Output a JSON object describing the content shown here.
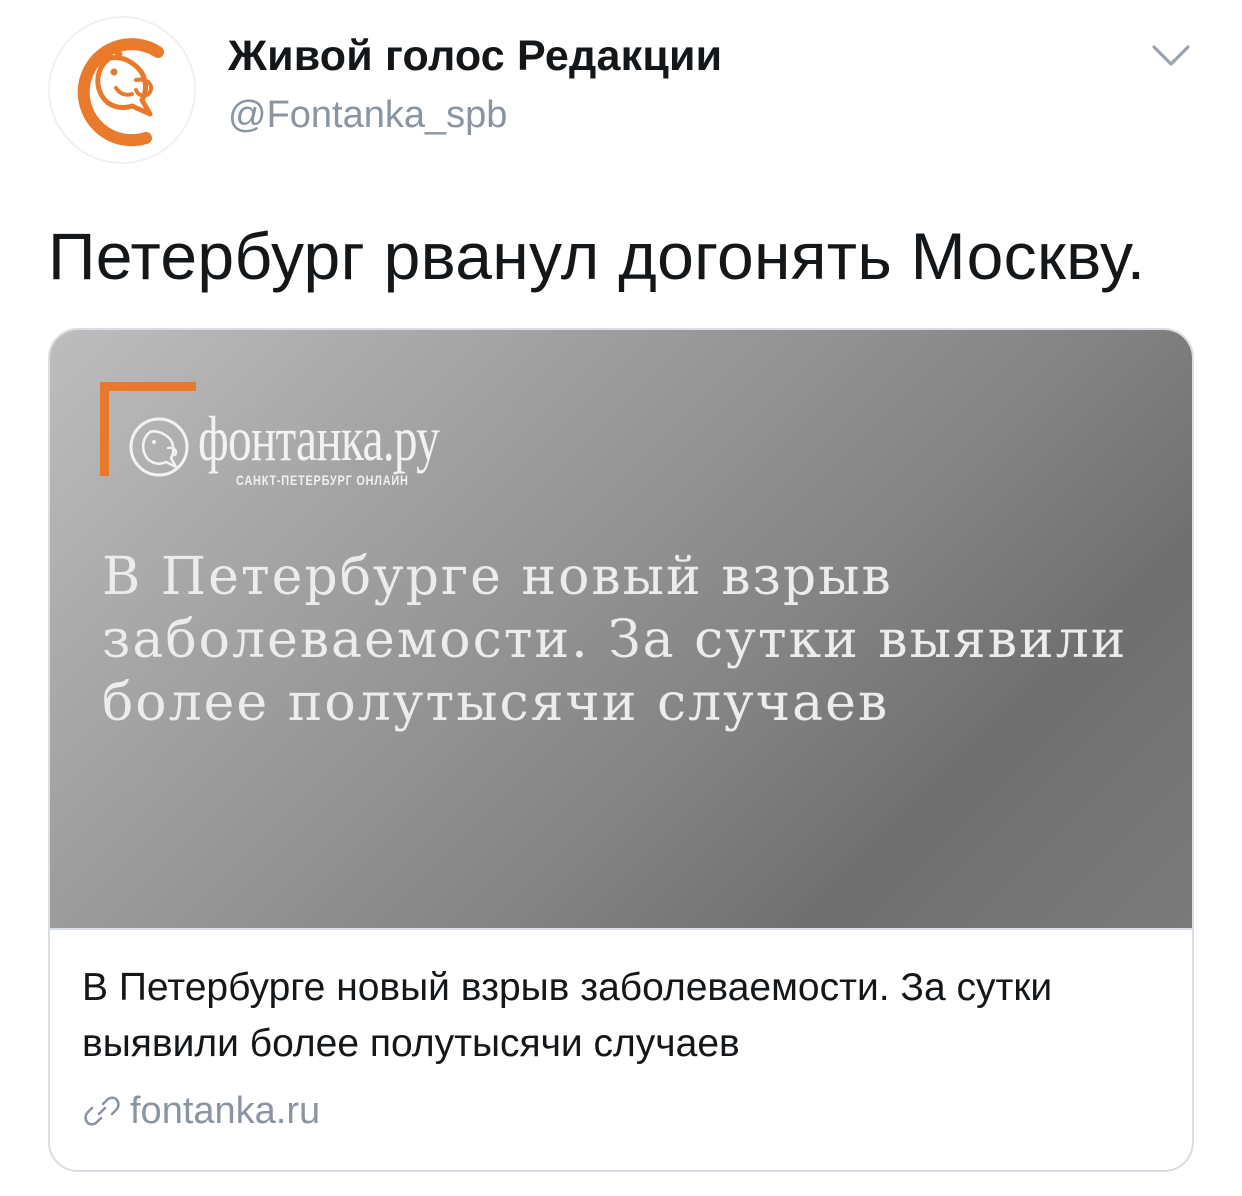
{
  "tweet": {
    "author": {
      "display_name": "Живой голос Редакции",
      "handle": "@Fontanka_spb"
    },
    "text": "Петербург рванул догонять Москву.",
    "card": {
      "image": {
        "logo_name": "фонтанка.ру",
        "logo_tagline": "САНКТ-ПЕТЕРБУРГ ОНЛАЙН",
        "headline": "В Петербурге новый взрыв заболеваемости. За сутки выявили более полутысячи случаев"
      },
      "title": "В Петербурге новый взрыв заболеваемости. За сутки выявили более полутысячи случаев",
      "domain": "fontanka.ru"
    }
  },
  "icons": {
    "avatar": "fontanka-bird-logo",
    "menu": "chevron-down-icon",
    "link": "link-icon"
  },
  "colors": {
    "brand_orange": "#e8782a",
    "text_primary": "#14171a",
    "text_secondary": "#8a95a1",
    "card_border": "#d8dee3"
  }
}
